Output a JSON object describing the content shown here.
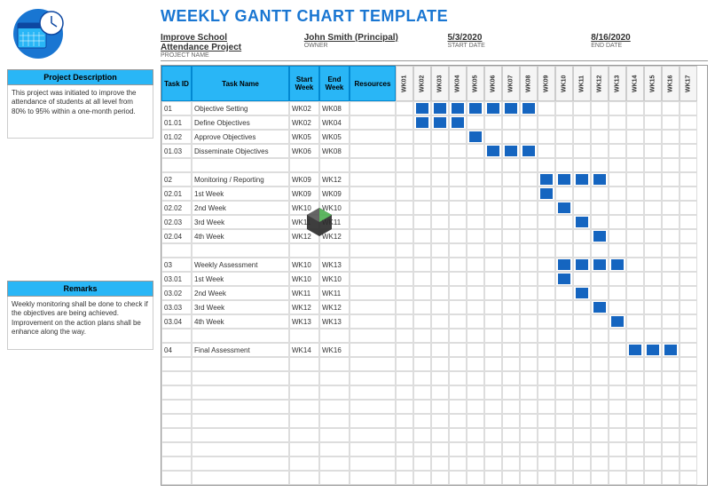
{
  "title": "WEEKLY GANTT CHART TEMPLATE",
  "meta": {
    "project_name": {
      "value": "Improve School Attendance Project",
      "label": "PROJECT NAME"
    },
    "owner": {
      "value": "John Smith (Principal)",
      "label": "OWNER"
    },
    "start_date": {
      "value": "5/3/2020",
      "label": "START DATE"
    },
    "end_date": {
      "value": "8/16/2020",
      "label": "END DATE"
    }
  },
  "sidebar": {
    "description": {
      "header": "Project Description",
      "body": "This project was initiated to improve the attendance of students at all level from 80% to 95% within a one-month period."
    },
    "remarks": {
      "header": "Remarks",
      "body": "Weekly monitoring shall be done to check if the objectives are being achieved.\nImprovement on the action plans shall be enhance along the way."
    }
  },
  "headers": {
    "task_id": "Task ID",
    "task_name": "Task Name",
    "start_week": "Start Week",
    "end_week": "End Week",
    "resources": "Resources"
  },
  "weeks": [
    "WK01",
    "WK02",
    "WK03",
    "WK04",
    "WK05",
    "WK06",
    "WK07",
    "WK08",
    "WK09",
    "WK10",
    "WK11",
    "WK12",
    "WK13",
    "WK14",
    "WK15",
    "WK16",
    "WK17"
  ],
  "tasks": [
    {
      "id": "01",
      "name": "Objective Setting",
      "start": "WK02",
      "end": "WK08",
      "res": "",
      "bars": [
        2,
        3,
        4,
        5,
        6,
        7,
        8
      ]
    },
    {
      "id": "01.01",
      "name": "Define Objectives",
      "start": "WK02",
      "end": "WK04",
      "res": "",
      "bars": [
        2,
        3,
        4
      ]
    },
    {
      "id": "01.02",
      "name": "Approve Objectives",
      "start": "WK05",
      "end": "WK05",
      "res": "",
      "bars": [
        5
      ]
    },
    {
      "id": "01.03",
      "name": "Disseminate Objectives",
      "start": "WK06",
      "end": "WK08",
      "res": "",
      "bars": [
        6,
        7,
        8
      ]
    },
    {
      "id": "",
      "name": "",
      "start": "",
      "end": "",
      "res": "",
      "bars": []
    },
    {
      "id": "02",
      "name": "Monitoring / Reporting",
      "start": "WK09",
      "end": "WK12",
      "res": "",
      "bars": [
        9,
        10,
        11,
        12
      ]
    },
    {
      "id": "02.01",
      "name": "1st Week",
      "start": "WK09",
      "end": "WK09",
      "res": "",
      "bars": [
        9
      ]
    },
    {
      "id": "02.02",
      "name": "2nd Week",
      "start": "WK10",
      "end": "WK10",
      "res": "",
      "bars": [
        10
      ]
    },
    {
      "id": "02.03",
      "name": "3rd Week",
      "start": "WK11",
      "end": "WK11",
      "res": "",
      "bars": [
        11
      ]
    },
    {
      "id": "02.04",
      "name": "4th Week",
      "start": "WK12",
      "end": "WK12",
      "res": "",
      "bars": [
        12
      ]
    },
    {
      "id": "",
      "name": "",
      "start": "",
      "end": "",
      "res": "",
      "bars": []
    },
    {
      "id": "03",
      "name": "Weekly Assessment",
      "start": "WK10",
      "end": "WK13",
      "res": "",
      "bars": [
        10,
        11,
        12,
        13
      ]
    },
    {
      "id": "03.01",
      "name": "1st Week",
      "start": "WK10",
      "end": "WK10",
      "res": "",
      "bars": [
        10
      ]
    },
    {
      "id": "03.02",
      "name": "2nd Week",
      "start": "WK11",
      "end": "WK11",
      "res": "",
      "bars": [
        11
      ]
    },
    {
      "id": "03.03",
      "name": "3rd Week",
      "start": "WK12",
      "end": "WK12",
      "res": "",
      "bars": [
        12
      ]
    },
    {
      "id": "03.04",
      "name": "4th Week",
      "start": "WK13",
      "end": "WK13",
      "res": "",
      "bars": [
        13
      ]
    },
    {
      "id": "",
      "name": "",
      "start": "",
      "end": "",
      "res": "",
      "bars": []
    },
    {
      "id": "04",
      "name": "Final Assessment",
      "start": "WK14",
      "end": "WK16",
      "res": "",
      "bars": [
        14,
        15,
        16
      ]
    },
    {
      "id": "",
      "name": "",
      "start": "",
      "end": "",
      "res": "",
      "bars": []
    },
    {
      "id": "",
      "name": "",
      "start": "",
      "end": "",
      "res": "",
      "bars": []
    },
    {
      "id": "",
      "name": "",
      "start": "",
      "end": "",
      "res": "",
      "bars": []
    },
    {
      "id": "",
      "name": "",
      "start": "",
      "end": "",
      "res": "",
      "bars": []
    },
    {
      "id": "",
      "name": "",
      "start": "",
      "end": "",
      "res": "",
      "bars": []
    },
    {
      "id": "",
      "name": "",
      "start": "",
      "end": "",
      "res": "",
      "bars": []
    },
    {
      "id": "",
      "name": "",
      "start": "",
      "end": "",
      "res": "",
      "bars": []
    },
    {
      "id": "",
      "name": "",
      "start": "",
      "end": "",
      "res": "",
      "bars": []
    },
    {
      "id": "",
      "name": "",
      "start": "",
      "end": "",
      "res": "",
      "bars": []
    }
  ],
  "chart_data": {
    "type": "gantt",
    "title": "Weekly Gantt Chart Template",
    "x": [
      "WK01",
      "WK02",
      "WK03",
      "WK04",
      "WK05",
      "WK06",
      "WK07",
      "WK08",
      "WK09",
      "WK10",
      "WK11",
      "WK12",
      "WK13",
      "WK14",
      "WK15",
      "WK16",
      "WK17"
    ],
    "series": [
      {
        "name": "Objective Setting",
        "id": "01",
        "start": 2,
        "end": 8
      },
      {
        "name": "Define Objectives",
        "id": "01.01",
        "start": 2,
        "end": 4
      },
      {
        "name": "Approve Objectives",
        "id": "01.02",
        "start": 5,
        "end": 5
      },
      {
        "name": "Disseminate Objectives",
        "id": "01.03",
        "start": 6,
        "end": 8
      },
      {
        "name": "Monitoring / Reporting",
        "id": "02",
        "start": 9,
        "end": 12
      },
      {
        "name": "1st Week",
        "id": "02.01",
        "start": 9,
        "end": 9
      },
      {
        "name": "2nd Week",
        "id": "02.02",
        "start": 10,
        "end": 10
      },
      {
        "name": "3rd Week",
        "id": "02.03",
        "start": 11,
        "end": 11
      },
      {
        "name": "4th Week",
        "id": "02.04",
        "start": 12,
        "end": 12
      },
      {
        "name": "Weekly Assessment",
        "id": "03",
        "start": 10,
        "end": 13
      },
      {
        "name": "1st Week",
        "id": "03.01",
        "start": 10,
        "end": 10
      },
      {
        "name": "2nd Week",
        "id": "03.02",
        "start": 11,
        "end": 11
      },
      {
        "name": "3rd Week",
        "id": "03.03",
        "start": 12,
        "end": 12
      },
      {
        "name": "4th Week",
        "id": "03.04",
        "start": 13,
        "end": 13
      },
      {
        "name": "Final Assessment",
        "id": "04",
        "start": 14,
        "end": 16
      }
    ]
  }
}
